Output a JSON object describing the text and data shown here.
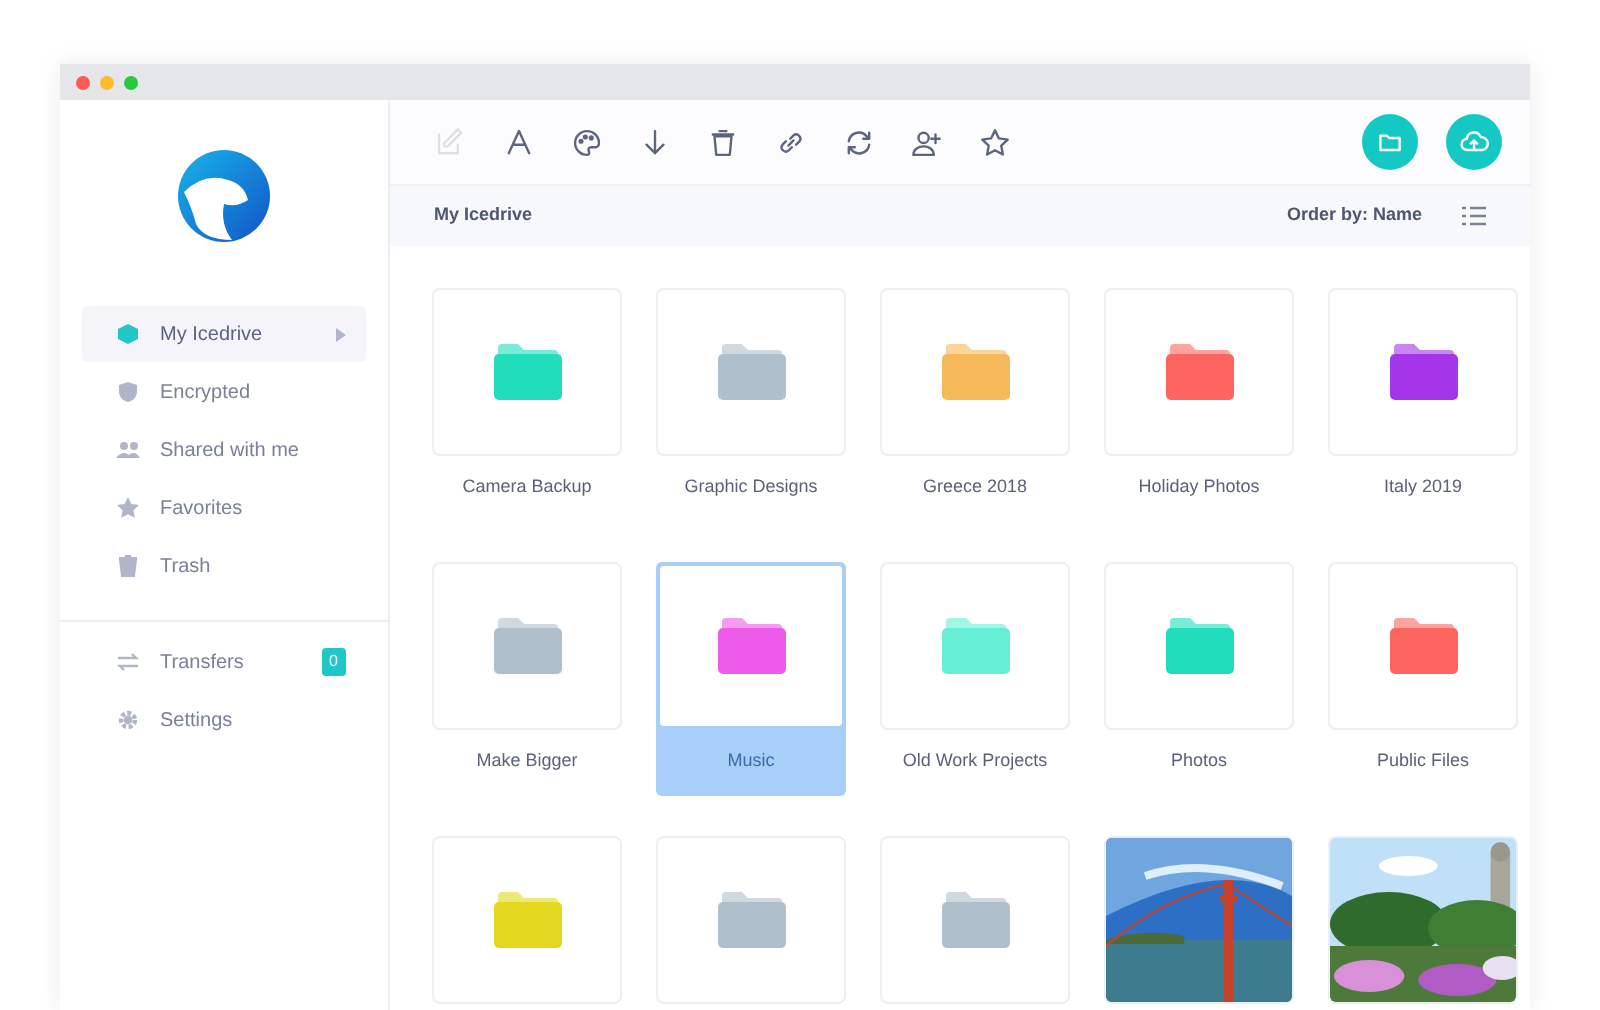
{
  "sidebar": {
    "items": [
      {
        "label": "My Icedrive",
        "kind": "drive",
        "selected": true
      },
      {
        "label": "Encrypted",
        "kind": "shield",
        "selected": false
      },
      {
        "label": "Shared with me",
        "kind": "people",
        "selected": false
      },
      {
        "label": "Favorites",
        "kind": "star",
        "selected": false
      },
      {
        "label": "Trash",
        "kind": "trash",
        "selected": false
      }
    ],
    "bottom_items": [
      {
        "label": "Transfers",
        "kind": "transfers",
        "badge": "0"
      },
      {
        "label": "Settings",
        "kind": "gear"
      }
    ]
  },
  "toolbar": [
    {
      "kind": "edit",
      "disabled": true
    },
    {
      "kind": "text",
      "disabled": false
    },
    {
      "kind": "palette",
      "disabled": false
    },
    {
      "kind": "download",
      "disabled": false
    },
    {
      "kind": "trash",
      "disabled": false
    },
    {
      "kind": "link",
      "disabled": false
    },
    {
      "kind": "sync",
      "disabled": false
    },
    {
      "kind": "add-user",
      "disabled": false
    },
    {
      "kind": "star",
      "disabled": false
    }
  ],
  "actions": [
    {
      "kind": "new-folder"
    },
    {
      "kind": "upload"
    }
  ],
  "breadcrumb": "My Icedrive",
  "order_by": "Order by: Name",
  "items": [
    {
      "kind": "folder",
      "name": "Camera Backup",
      "color": "#22ddbb",
      "selected": false
    },
    {
      "kind": "folder",
      "name": "Graphic Designs",
      "color": "#b0bfcc",
      "selected": false
    },
    {
      "kind": "folder",
      "name": "Greece 2018",
      "color": "#f5b95a",
      "selected": false
    },
    {
      "kind": "folder",
      "name": "Holiday Photos",
      "color": "#fd665f",
      "selected": false
    },
    {
      "kind": "folder",
      "name": "Italy 2019",
      "color": "#a435e8",
      "selected": false
    },
    {
      "kind": "folder",
      "name": "Make Bigger",
      "color": "#b0bfcc",
      "selected": false
    },
    {
      "kind": "folder",
      "name": "Music",
      "color": "#ee5be8",
      "selected": true
    },
    {
      "kind": "folder",
      "name": "Old Work Projects",
      "color": "#66eed6",
      "selected": false
    },
    {
      "kind": "folder",
      "name": "Photos",
      "color": "#22ddbb",
      "selected": false
    },
    {
      "kind": "folder",
      "name": "Public Files",
      "color": "#fd665f",
      "selected": false
    },
    {
      "kind": "folder",
      "color": "#e3d81e",
      "selected": false
    },
    {
      "kind": "folder",
      "color": "#b0bfcc",
      "selected": false
    },
    {
      "kind": "folder",
      "color": "#b0bfcc",
      "selected": false
    },
    {
      "kind": "picture",
      "selected": false
    },
    {
      "kind": "picture",
      "selected": false
    }
  ]
}
